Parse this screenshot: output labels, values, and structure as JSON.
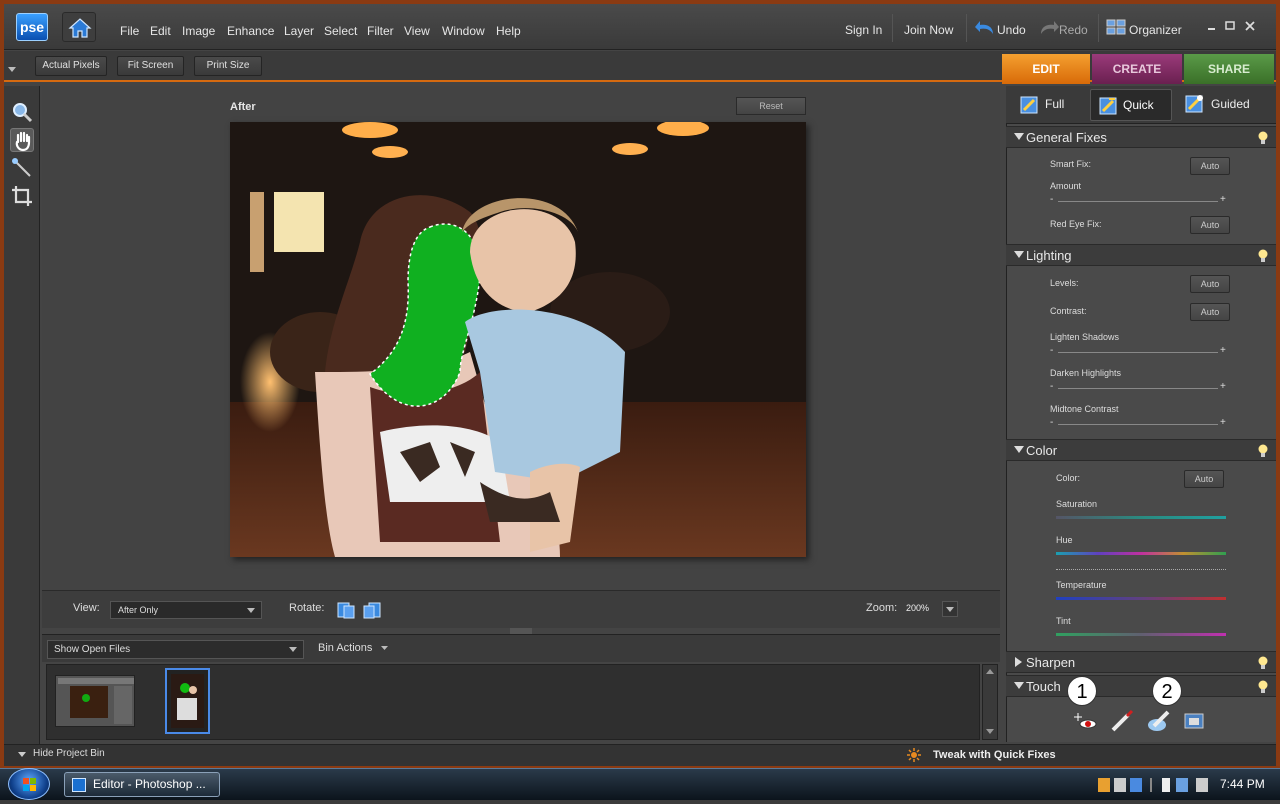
{
  "menubar": {
    "logo": "pse",
    "items": [
      "File",
      "Edit",
      "Image",
      "Enhance",
      "Layer",
      "Select",
      "Filter",
      "View",
      "Window",
      "Help"
    ],
    "sign_in": "Sign In",
    "join_now": "Join Now",
    "undo": "Undo",
    "redo": "Redo",
    "organizer": "Organizer"
  },
  "optbar": {
    "actual_pixels": "Actual Pixels",
    "fit_screen": "Fit Screen",
    "print_size": "Print Size"
  },
  "mode_tabs": {
    "edit": "EDIT",
    "create": "CREATE",
    "share": "SHARE",
    "colors": {
      "edit": "#e8820c",
      "create": "#8a2f6a",
      "share": "#4a8a3a"
    }
  },
  "canvas": {
    "title": "After",
    "reset": "Reset"
  },
  "viewbar": {
    "view_label": "View:",
    "view_value": "After Only",
    "rotate_label": "Rotate:",
    "zoom_label": "Zoom:",
    "zoom_value": "200%"
  },
  "bin": {
    "show": "Show Open Files",
    "actions": "Bin Actions",
    "hide": "Hide Project Bin"
  },
  "status": {
    "tweak": "Tweak with Quick Fixes"
  },
  "panel": {
    "subtabs": {
      "full": "Full",
      "quick": "Quick",
      "guided": "Guided"
    },
    "general": {
      "title": "General Fixes",
      "smart_fix": "Smart Fix:",
      "amount": "Amount",
      "red_eye": "Red Eye Fix:",
      "auto": "Auto"
    },
    "lighting": {
      "title": "Lighting",
      "levels": "Levels:",
      "contrast": "Contrast:",
      "lighten": "Lighten Shadows",
      "darken": "Darken Highlights",
      "midtone": "Midtone Contrast"
    },
    "color": {
      "title": "Color",
      "color_label": "Color:",
      "saturation": "Saturation",
      "hue": "Hue",
      "temperature": "Temperature",
      "tint": "Tint"
    },
    "sharpen": {
      "title": "Sharpen"
    },
    "touch": {
      "title": "Touch"
    },
    "minus": "-",
    "plus": "+"
  },
  "callouts": [
    "1",
    "2"
  ],
  "taskbar": {
    "task": "Editor - Photoshop ...",
    "clock": "7:44 PM"
  }
}
